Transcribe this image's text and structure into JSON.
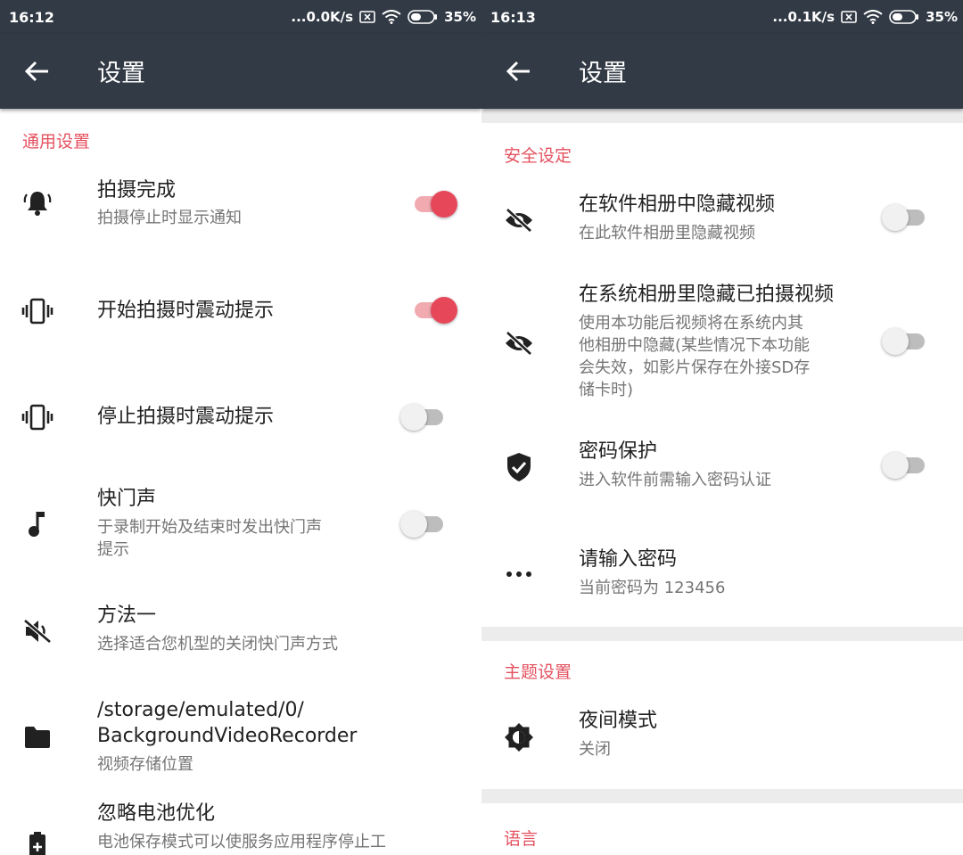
{
  "left_screen": {
    "status": {
      "time": "16:12",
      "speed": "...0.0K/s",
      "battery": "35%"
    },
    "title": "设置",
    "category": "通用设置",
    "items": [
      {
        "title": "拍摄完成",
        "summary": "拍摄停止时显示通知",
        "icon": "bell-ring-icon",
        "toggle": true
      },
      {
        "title": "开始拍摄时震动提示",
        "icon": "vibrate-icon",
        "toggle": true
      },
      {
        "title": "停止拍摄时震动提示",
        "icon": "vibrate-icon",
        "toggle": false
      },
      {
        "title": "快门声",
        "summary": "于录制开始及结束时发出快门声",
        "summary2": "提示",
        "icon": "music-note-icon",
        "toggle": false
      },
      {
        "title": "方法一",
        "summary": "选择适合您机型的关闭快门声方式",
        "icon": "volume-off-icon"
      },
      {
        "title": "/storage/emulated/0/",
        "title2": "BackgroundVideoRecorder",
        "summary": "视频存储位置",
        "icon": "folder-icon"
      },
      {
        "title": "忽略电池优化",
        "summary": "电池保存模式可以使服务应用程序停止工",
        "icon": "battery-plus-icon"
      }
    ]
  },
  "right_screen": {
    "status": {
      "time": "16:13",
      "speed": "...0.1K/s",
      "battery": "35%"
    },
    "title": "设置",
    "security": {
      "category": "安全设定",
      "items": [
        {
          "title": "在软件相册中隐藏视频",
          "summary": "在此软件相册里隐藏视频",
          "icon": "eye-off-icon",
          "toggle": false
        },
        {
          "title": "在系统相册里隐藏已拍摄视频",
          "summary_lines": [
            "使用本功能后视频将在系统内其",
            "他相册中隐藏(某些情况下本功能",
            "会失效，如影片保存在外接SD存",
            "储卡时)"
          ],
          "icon": "eye-off-icon",
          "toggle": false
        },
        {
          "title": "密码保护",
          "summary": "进入软件前需输入密码认证",
          "icon": "shield-check-icon",
          "toggle": false
        },
        {
          "title": "请输入密码",
          "summary": "当前密码为 123456",
          "icon": "dots-icon"
        }
      ]
    },
    "theme": {
      "category": "主题设置",
      "items": [
        {
          "title": "夜间模式",
          "summary": "关闭",
          "icon": "brightness-icon"
        }
      ]
    },
    "language": {
      "category": "语言"
    }
  },
  "colors": {
    "appbar": "#323a45",
    "accent": "#e4515f",
    "switch_on": "#e6485a"
  }
}
